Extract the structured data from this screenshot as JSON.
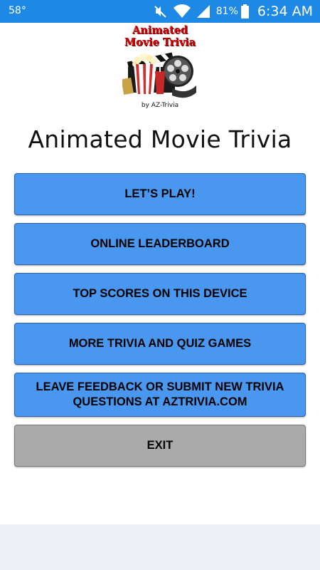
{
  "status_bar": {
    "temperature": "58°",
    "battery_percent": "81%",
    "time": "6:34 AM"
  },
  "logo": {
    "title_line1": "Animated",
    "title_line2": "Movie Trivia",
    "byline": "by AZ-Trivia"
  },
  "app_title": "Animated Movie Trivia",
  "buttons": {
    "play": "LET’S PLAY!",
    "leaderboard": "ONLINE LEADERBOARD",
    "top_scores": "TOP SCORES ON THIS DEVICE",
    "more_games": "MORE TRIVIA AND QUIZ GAMES",
    "feedback_line1": "LEAVE FEEDBACK OR SUBMIT NEW TRIVIA",
    "feedback_line2": "QUESTIONS AT AZTRIVIA.COM",
    "exit": "EXIT"
  },
  "colors": {
    "status_bar": "#1e88e5",
    "button_blue": "#4a97ef",
    "button_exit": "#aaaaaa"
  }
}
